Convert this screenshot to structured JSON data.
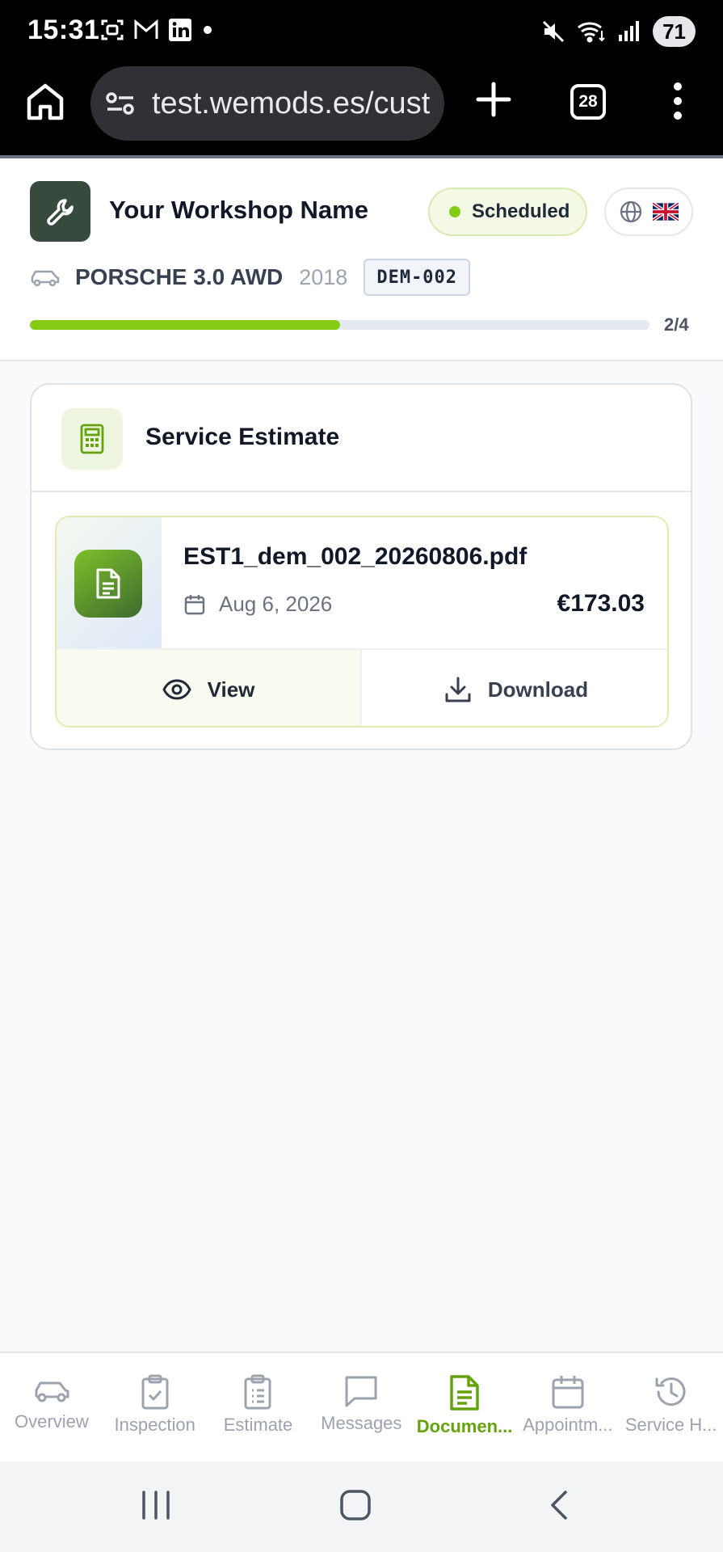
{
  "status_bar": {
    "time": "15:31",
    "battery": "71",
    "left_icons": [
      "screenshot-icon",
      "gmail-icon",
      "linkedin-icon",
      "dot-icon"
    ],
    "right_icons": [
      "mute-icon",
      "wifi-icon",
      "signal-icon"
    ]
  },
  "browser": {
    "url": "test.wemods.es/cust",
    "tab_count": "28"
  },
  "header": {
    "workshop_name": "Your Workshop Name",
    "status": "Scheduled",
    "status_color": "#84cc16",
    "vehicle_model": "PORSCHE 3.0 AWD",
    "vehicle_year": "2018",
    "plate": "DEM-002",
    "progress_label": "2/4",
    "progress_fraction": 0.5
  },
  "card": {
    "title": "Service Estimate",
    "document": {
      "filename": "EST1_dem_002_20260806.pdf",
      "date": "Aug 6, 2026",
      "amount": "€173.03",
      "view_label": "View",
      "download_label": "Download"
    }
  },
  "bottom_nav": {
    "items": [
      {
        "label": "Overview",
        "icon": "car-icon",
        "active": false
      },
      {
        "label": "Inspection",
        "icon": "clipboard-check-icon",
        "active": false
      },
      {
        "label": "Estimate",
        "icon": "clipboard-list-icon",
        "active": false
      },
      {
        "label": "Messages",
        "icon": "message-icon",
        "active": false
      },
      {
        "label": "Documen...",
        "icon": "document-icon",
        "active": true
      },
      {
        "label": "Appointm...",
        "icon": "calendar-icon",
        "active": false
      },
      {
        "label": "Service H...",
        "icon": "history-icon",
        "active": false
      }
    ]
  },
  "colors": {
    "accent": "#84cc16",
    "accent_dark": "#65a30d",
    "brand_logo": "#374a3e"
  }
}
